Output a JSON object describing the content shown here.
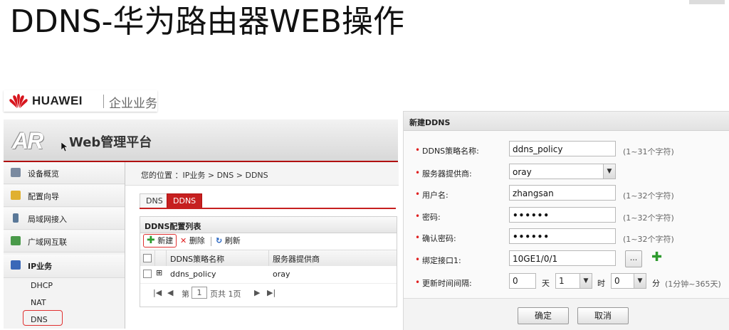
{
  "slide": {
    "title": "DDNS-华为路由器WEB操作"
  },
  "brand": {
    "name": "HUAWEI",
    "tagline": "企业业务"
  },
  "header": {
    "logo_text": "AR",
    "platform_title": "Web管理平台"
  },
  "sidebar": {
    "items": [
      {
        "label": "设备概览"
      },
      {
        "label": "配置向导"
      },
      {
        "label": "局域网接入"
      },
      {
        "label": "广域网互联"
      },
      {
        "label": "IP业务"
      }
    ],
    "sub_items": [
      {
        "label": "DHCP"
      },
      {
        "label": "NAT"
      },
      {
        "label": "DNS"
      }
    ]
  },
  "main": {
    "breadcrumb": "您的位置 ：IP业务 > DNS > DDNS",
    "tabs": [
      {
        "label": "DNS"
      },
      {
        "label": "DDNS"
      }
    ],
    "panel_title": "DDNS配置列表",
    "toolbar": {
      "new_label": "新建",
      "delete_label": "删除",
      "refresh_label": "刷新"
    },
    "columns": [
      "DDNS策略名称",
      "服务器提供商"
    ],
    "rows": [
      {
        "policy": "ddns_policy",
        "provider": "oray"
      }
    ],
    "pager": {
      "first": "|◀",
      "prev": "◀",
      "page_prefix": "第",
      "page_value": "1",
      "page_suffix": "页共 1页",
      "next": "▶",
      "last": "▶|"
    }
  },
  "dialog": {
    "title": "新建DDNS",
    "fields": {
      "policy_name": {
        "label": "DDNS策略名称:",
        "value": "ddns_policy",
        "hint": "(1~31个字符)"
      },
      "provider": {
        "label": "服务器提供商:",
        "value": "oray"
      },
      "username": {
        "label": "用户名:",
        "value": "zhangsan",
        "hint": "(1~32个字符)"
      },
      "password": {
        "label": "密码:",
        "value": "••••••",
        "hint": "(1~32个字符)"
      },
      "confirm_password": {
        "label": "确认密码:",
        "value": "••••••",
        "hint": "(1~32个字符)"
      },
      "interface": {
        "label": "绑定接口1:",
        "value": "10GE1/0/1",
        "browse": "..."
      },
      "interval": {
        "label": "更新时间间隔:",
        "days": "0",
        "days_unit": "天",
        "hours": "1",
        "hours_unit": "时",
        "minutes": "0",
        "minutes_unit": "分",
        "hint": "(1分钟~365天)"
      }
    },
    "ok_label": "确定",
    "cancel_label": "取消"
  },
  "colors": {
    "accent_red": "#c62020",
    "highlight_red": "#e03030",
    "add_green": "#2d9a2d"
  }
}
